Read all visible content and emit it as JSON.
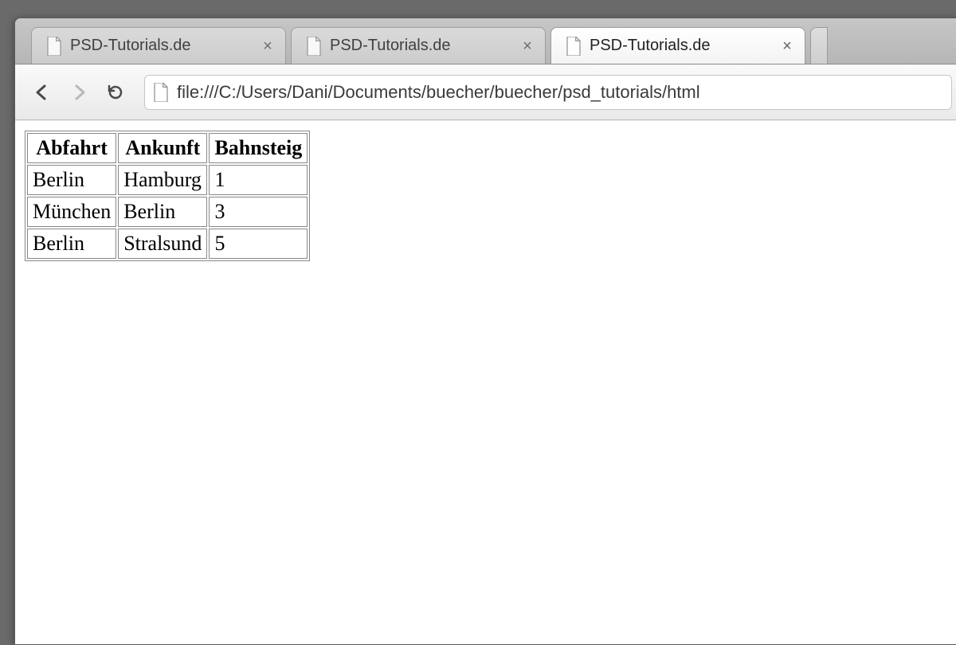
{
  "tabs": [
    {
      "title": "PSD-Tutorials.de",
      "active": false
    },
    {
      "title": "PSD-Tutorials.de",
      "active": false
    },
    {
      "title": "PSD-Tutorials.de",
      "active": true
    }
  ],
  "address_bar": {
    "url": "file:///C:/Users/Dani/Documents/buecher/buecher/psd_tutorials/html"
  },
  "table": {
    "headers": [
      "Abfahrt",
      "Ankunft",
      "Bahnsteig"
    ],
    "rows": [
      {
        "abfahrt": "Berlin",
        "ankunft": "Hamburg",
        "bahnsteig": "1"
      },
      {
        "abfahrt": "München",
        "ankunft": "Berlin",
        "bahnsteig": "3"
      },
      {
        "abfahrt": "Berlin",
        "ankunft": "Stralsund",
        "bahnsteig": "5"
      }
    ]
  }
}
